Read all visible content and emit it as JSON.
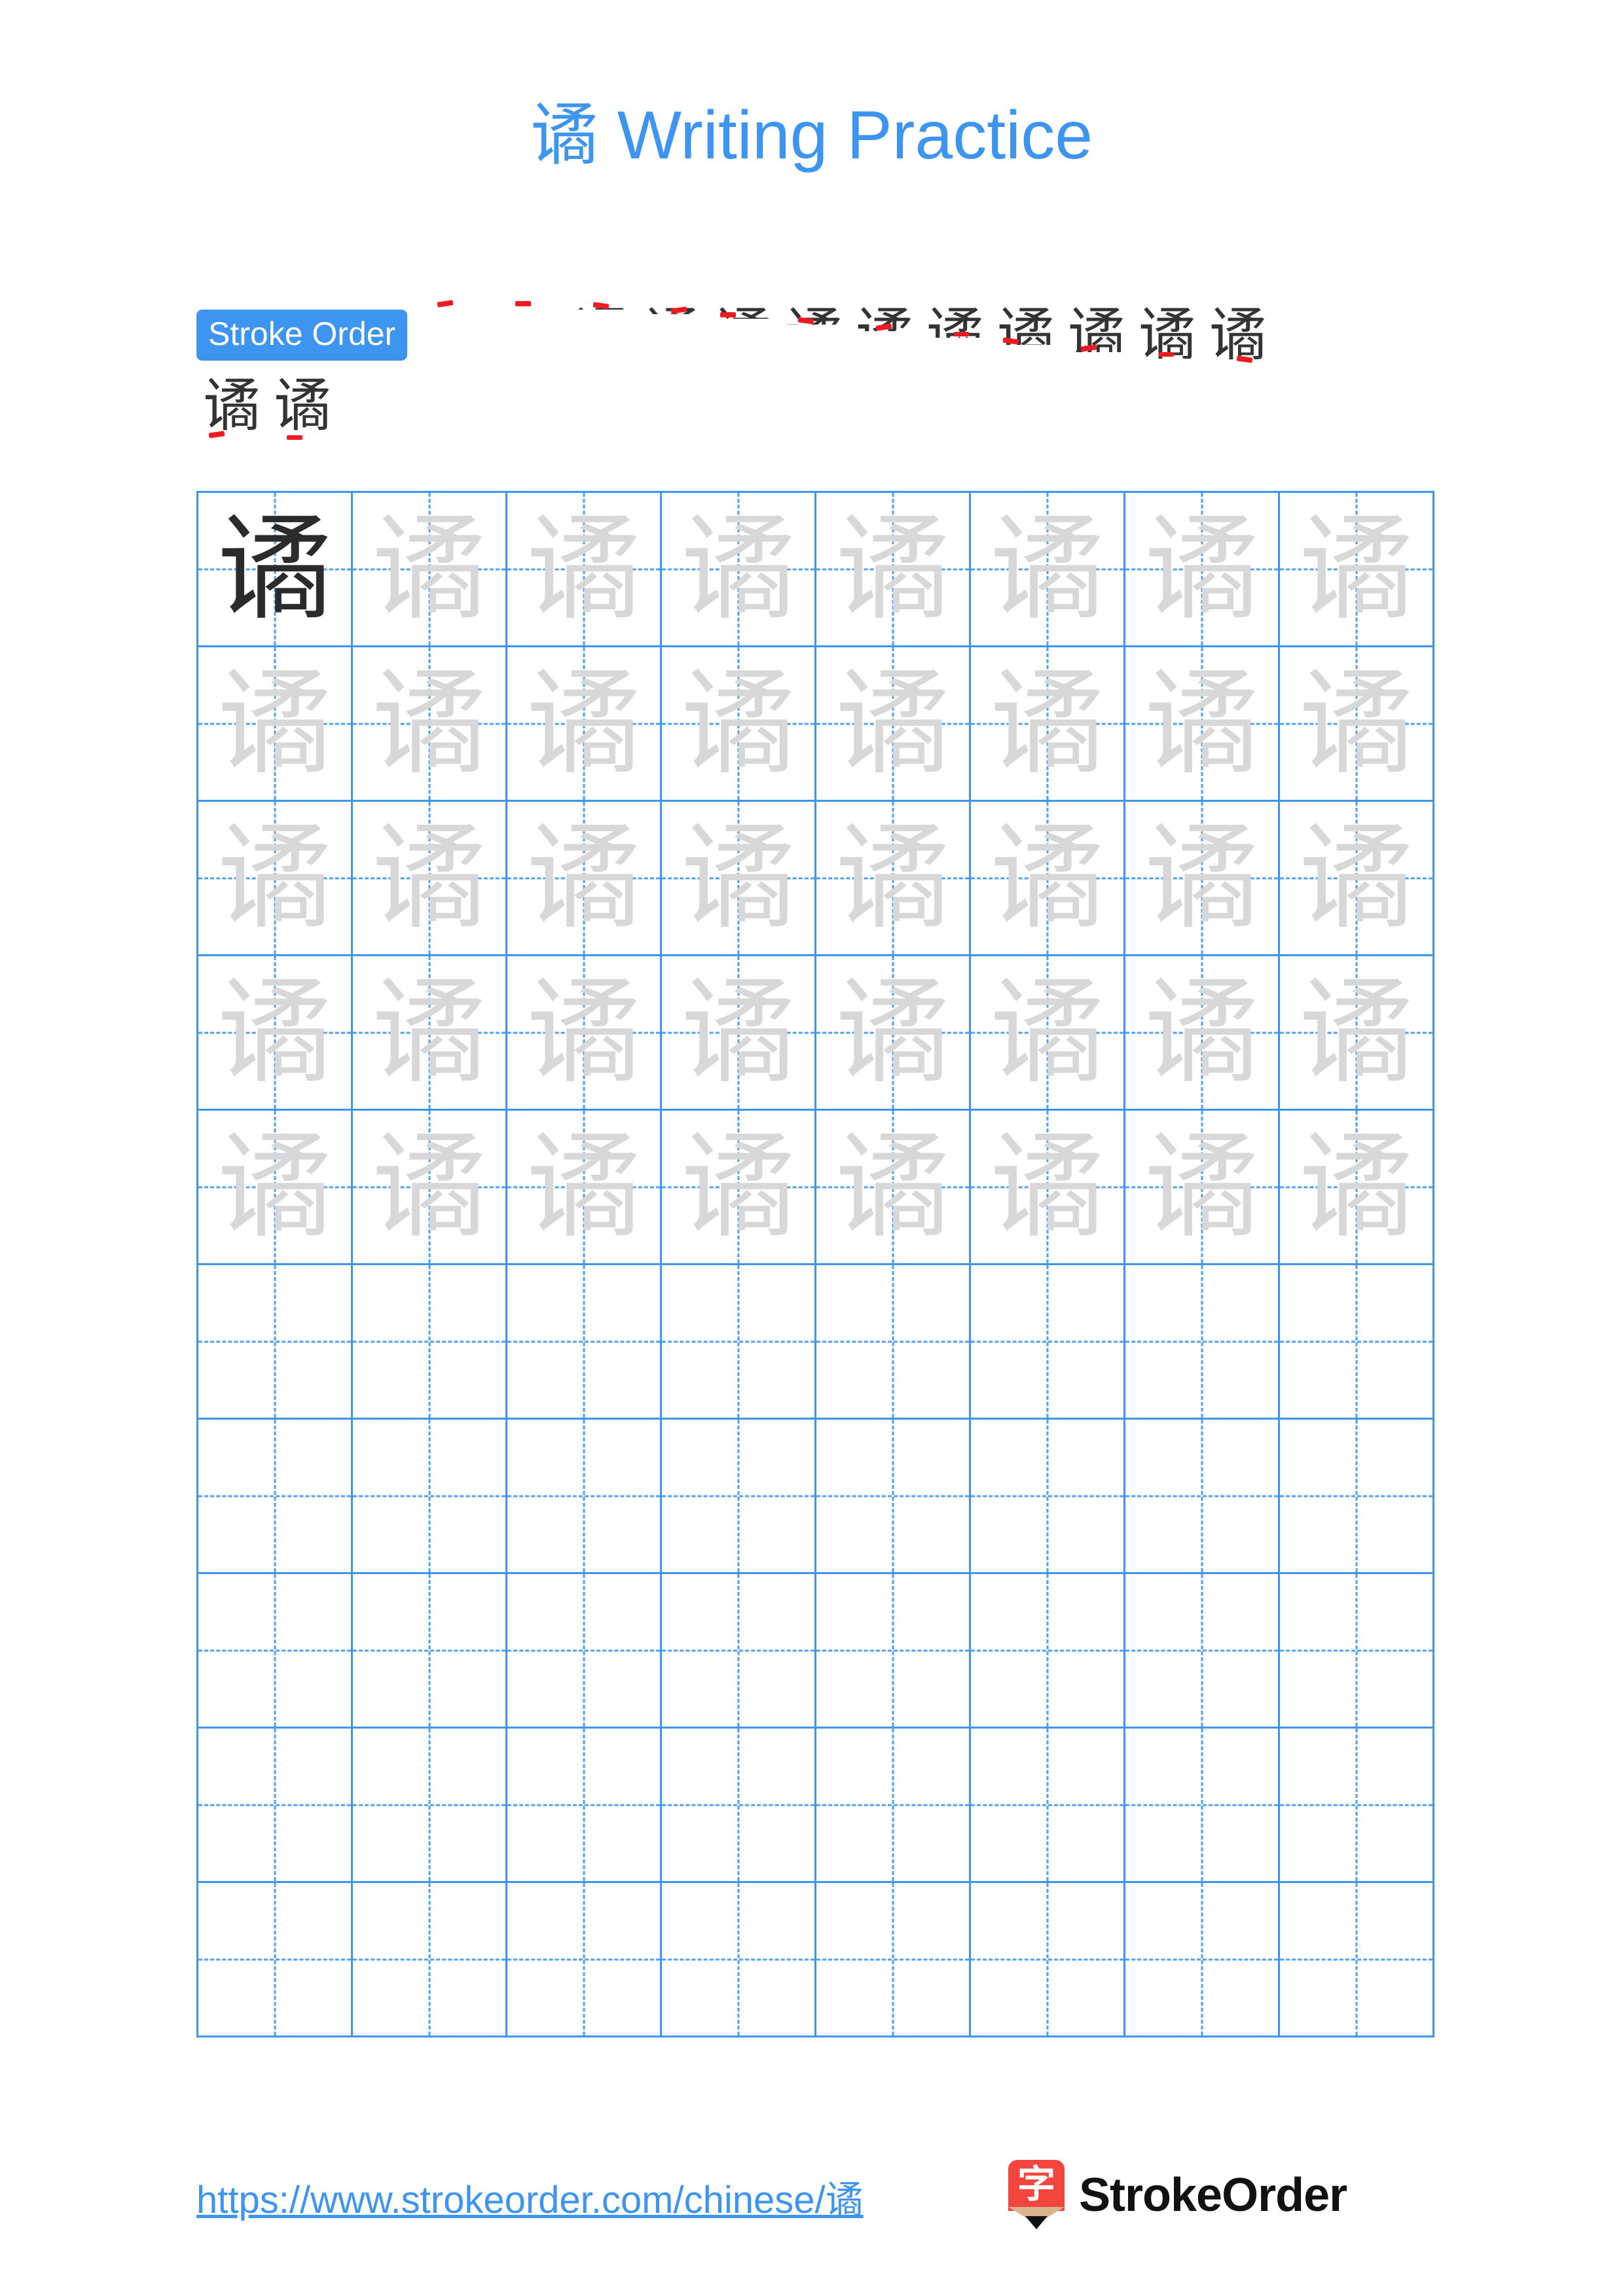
{
  "page": {
    "character": "谲",
    "title": "谲 Writing Practice",
    "background_color": "#ffffff",
    "accent_color": "#3e95f0",
    "stroke_new_color": "#ee1c22",
    "stroke_prev_color": "#333333",
    "grid_line_color": "#3e95f0",
    "guide_line_color": "#4ea0f5",
    "trace_char_color": "#d8d8d8",
    "model_char_color": "#2b2b2b"
  },
  "stroke_order": {
    "badge_label": "Stroke Order",
    "total_strokes": 14,
    "steps": [
      {
        "index": 1,
        "char": "谲",
        "reveal": 4,
        "new_stroke": "dian"
      },
      {
        "index": 2,
        "char": "谲",
        "reveal": 9,
        "new_stroke": "hengzhe-tigou"
      },
      {
        "index": 3,
        "char": "谲",
        "reveal": 14,
        "new_stroke": "heng"
      },
      {
        "index": 4,
        "char": "谲",
        "reveal": 20,
        "new_stroke": "pie"
      },
      {
        "index": 5,
        "char": "谲",
        "reveal": 27,
        "new_stroke": "hengzhe"
      },
      {
        "index": 6,
        "char": "谲",
        "reveal": 35,
        "new_stroke": "heng"
      },
      {
        "index": 7,
        "char": "谲",
        "reveal": 44,
        "new_stroke": "shugou"
      },
      {
        "index": 8,
        "char": "谲",
        "reveal": 54,
        "new_stroke": "pie"
      },
      {
        "index": 9,
        "char": "谲",
        "reveal": 64,
        "new_stroke": "shu"
      },
      {
        "index": 10,
        "char": "谲",
        "reveal": 74,
        "new_stroke": "hengzhe"
      },
      {
        "index": 11,
        "char": "谲",
        "reveal": 83,
        "new_stroke": "heng"
      },
      {
        "index": 12,
        "char": "谲",
        "reveal": 90,
        "new_stroke": "shu"
      },
      {
        "index": 13,
        "char": "谲",
        "reveal": 96,
        "new_stroke": "heng"
      },
      {
        "index": 14,
        "char": "谲",
        "reveal": 100,
        "new_stroke": "heng"
      }
    ],
    "row_breaks": [
      12
    ]
  },
  "practice_grid": {
    "rows": 10,
    "columns": 8,
    "model_cell": {
      "row": 0,
      "column": 0
    },
    "traced_rows": 5,
    "blank_rows": 5,
    "cell_character": "谲"
  },
  "footer": {
    "url": "https://www.strokeorder.com/chinese/谲",
    "brand_name": "StrokeOrder",
    "brand_mark_character": "字",
    "brand_mark_color": "#f4463f",
    "brand_pencil_wood_color": "#d9b38c"
  }
}
